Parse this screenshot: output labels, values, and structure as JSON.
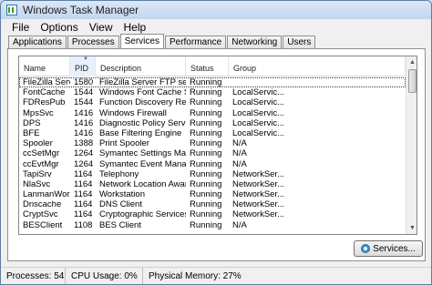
{
  "window": {
    "title": "Windows Task Manager",
    "icon": "task-manager-icon"
  },
  "menu": [
    "File",
    "Options",
    "View",
    "Help"
  ],
  "tabs": [
    {
      "label": "Applications",
      "active": false
    },
    {
      "label": "Processes",
      "active": false
    },
    {
      "label": "Services",
      "active": true
    },
    {
      "label": "Performance",
      "active": false
    },
    {
      "label": "Networking",
      "active": false
    },
    {
      "label": "Users",
      "active": false
    }
  ],
  "services_table": {
    "columns": [
      "Name",
      "PID",
      "Description",
      "Status",
      "Group"
    ],
    "sorted_column": "PID",
    "sort_icon": "sort-descending-icon",
    "rows": [
      [
        "FileZilla Server",
        "1580",
        "FileZilla Server FTP server",
        "Running",
        ""
      ],
      [
        "FontCache",
        "1544",
        "Windows Font Cache Ser...",
        "Running",
        "LocalServic..."
      ],
      [
        "FDResPub",
        "1544",
        "Function Discovery Reso...",
        "Running",
        "LocalServic..."
      ],
      [
        "MpsSvc",
        "1416",
        "Windows Firewall",
        "Running",
        "LocalServic..."
      ],
      [
        "DPS",
        "1416",
        "Diagnostic Policy Service",
        "Running",
        "LocalServic..."
      ],
      [
        "BFE",
        "1416",
        "Base Filtering Engine",
        "Running",
        "LocalServic..."
      ],
      [
        "Spooler",
        "1388",
        "Print Spooler",
        "Running",
        "N/A"
      ],
      [
        "ccSetMgr",
        "1264",
        "Symantec Settings Mana...",
        "Running",
        "N/A"
      ],
      [
        "ccEvtMgr",
        "1264",
        "Symantec Event Manager",
        "Running",
        "N/A"
      ],
      [
        "TapiSrv",
        "1164",
        "Telephony",
        "Running",
        "NetworkSer..."
      ],
      [
        "NlaSvc",
        "1164",
        "Network Location Aware...",
        "Running",
        "NetworkSer..."
      ],
      [
        "LanmanWor...",
        "1164",
        "Workstation",
        "Running",
        "NetworkSer..."
      ],
      [
        "Dnscache",
        "1164",
        "DNS Client",
        "Running",
        "NetworkSer..."
      ],
      [
        "CryptSvc",
        "1164",
        "Cryptographic Services",
        "Running",
        "NetworkSer..."
      ],
      [
        "BESClient",
        "1108",
        "BES Client",
        "Running",
        "N/A"
      ]
    ],
    "selected_row": 0
  },
  "services_button": {
    "label": "Services...",
    "icon": "services-gear-icon"
  },
  "status_bar": {
    "processes": "Processes: 54",
    "cpu": "CPU Usage: 0%",
    "memory": "Physical Memory: 27%"
  }
}
